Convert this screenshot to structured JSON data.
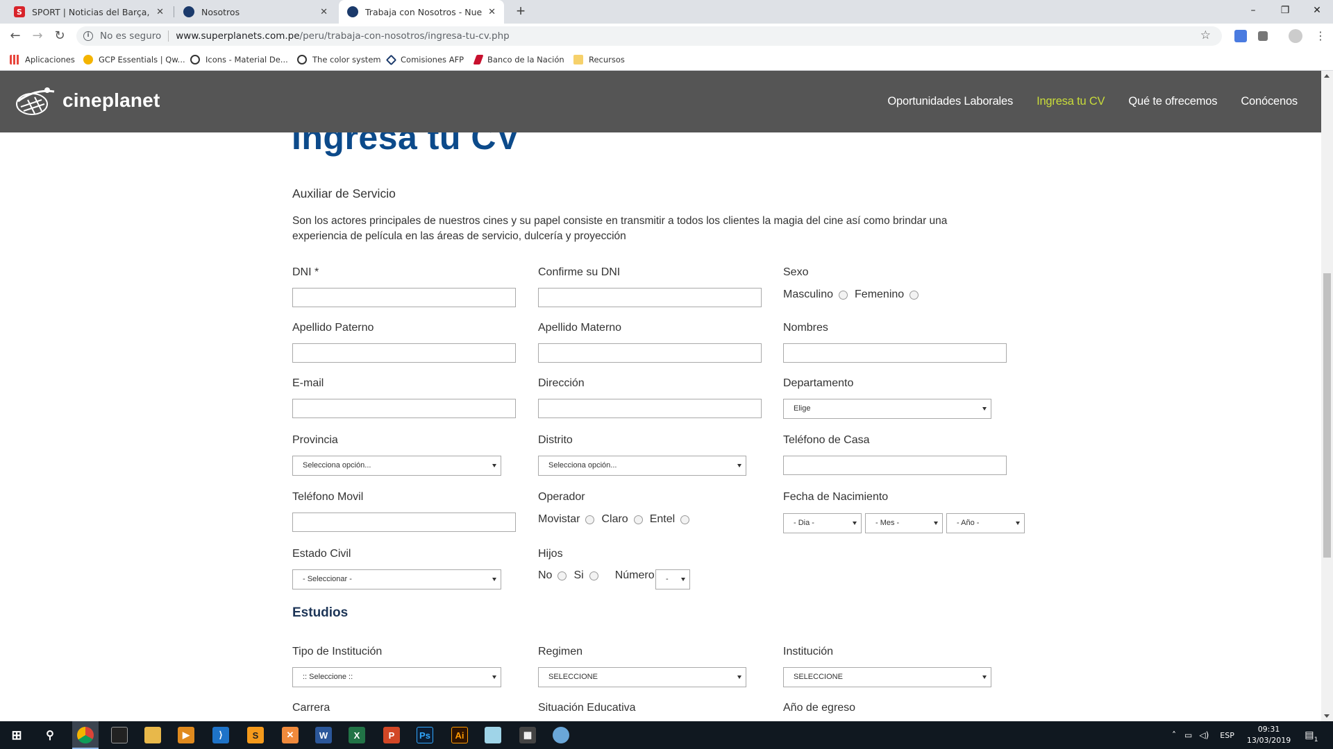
{
  "browser": {
    "tabs": [
      {
        "title": "SPORT | Noticias del Barça, La Liga",
        "favicon": "sport-favicon"
      },
      {
        "title": "Nosotros",
        "favicon": "cineplanet-favicon"
      },
      {
        "title": "Trabaja con Nosotros - Nuestra E",
        "favicon": "cineplanet-favicon",
        "active": true
      }
    ],
    "new_tab": "+",
    "window_controls": {
      "minimize": "–",
      "maximize": "❐",
      "close": "✕"
    },
    "address": {
      "security_label": "No es seguro",
      "host": "www.superplanets.com.pe",
      "path": "/peru/trabaja-con-nosotros/ingresa-tu-cv.php"
    },
    "nav": {
      "back": "←",
      "forward": "→",
      "reload": "↻"
    },
    "bookmarks": [
      {
        "label": "Aplicaciones",
        "color": "#e8453c"
      },
      {
        "label": "GCP Essentials | Qw...",
        "color": "#f4b400"
      },
      {
        "label": "Icons - Material De...",
        "color": "#333333"
      },
      {
        "label": "The color system",
        "color": "#333333"
      },
      {
        "label": "Comisiones AFP",
        "color": "#1b3a6b"
      },
      {
        "label": "Banco de la Nación",
        "color": "#c8102e"
      },
      {
        "label": "Recursos",
        "color": "#f6d16b"
      }
    ]
  },
  "site": {
    "logo_text": "cineplanet",
    "nav": [
      {
        "label": "Oportunidades Laborales",
        "active": false
      },
      {
        "label": "Ingresa tu CV",
        "active": true
      },
      {
        "label": "Qué te ofrecemos",
        "active": false
      },
      {
        "label": "Conócenos",
        "active": false
      }
    ],
    "accent_color": "#c9dc3a",
    "title_color": "#0c4a8a"
  },
  "page": {
    "title": "Ingresa tu CV",
    "job_title": "Auxiliar de Servicio",
    "job_description": "Son los actores principales de nuestros cines y su papel consiste en transmitir a todos los clientes la magia del cine así como brindar una experiencia de película en las áreas de servicio, dulcería y proyección"
  },
  "form": {
    "dni": {
      "label": "DNI *",
      "value": ""
    },
    "confirm_dni": {
      "label": "Confirme su DNI",
      "value": ""
    },
    "sexo": {
      "label": "Sexo",
      "options": [
        "Masculino",
        "Femenino"
      ]
    },
    "apellido_paterno": {
      "label": "Apellido Paterno",
      "value": ""
    },
    "apellido_materno": {
      "label": "Apellido Materno",
      "value": ""
    },
    "nombres": {
      "label": "Nombres",
      "value": ""
    },
    "email": {
      "label": "E-mail",
      "value": ""
    },
    "direccion": {
      "label": "Dirección",
      "value": ""
    },
    "departamento": {
      "label": "Departamento",
      "selected": "Elige"
    },
    "provincia": {
      "label": "Provincia",
      "selected": "Selecciona opción..."
    },
    "distrito": {
      "label": "Distrito",
      "selected": "Selecciona opción..."
    },
    "telefono_casa": {
      "label": "Teléfono de Casa",
      "value": ""
    },
    "telefono_movil": {
      "label": "Teléfono Movil",
      "value": ""
    },
    "operador": {
      "label": "Operador",
      "options": [
        "Movistar",
        "Claro",
        "Entel"
      ]
    },
    "fecha_nacimiento": {
      "label": "Fecha de Nacimiento",
      "dia": "- Dia -",
      "mes": "- Mes -",
      "anio": "- Año -"
    },
    "estado_civil": {
      "label": "Estado Civil",
      "selected": "- Seleccionar -"
    },
    "hijos": {
      "label": "Hijos",
      "options": [
        "No",
        "Si"
      ],
      "numero_label": "Número",
      "numero_selected": "-"
    },
    "estudios": {
      "title": "Estudios",
      "tipo_institucion": {
        "label": "Tipo de Institución",
        "selected": ":: Seleccione ::"
      },
      "regimen": {
        "label": "Regimen",
        "selected": "SELECCIONE"
      },
      "institucion": {
        "label": "Institución",
        "selected": "SELECCIONE"
      },
      "carrera": {
        "label": "Carrera"
      },
      "situacion_educativa": {
        "label": "Situación Educativa"
      },
      "anio_egreso": {
        "label": "Año de egreso"
      }
    }
  },
  "taskbar": {
    "language": "ESP",
    "time": "09:31",
    "date": "13/03/2019",
    "notification_count": "1"
  }
}
